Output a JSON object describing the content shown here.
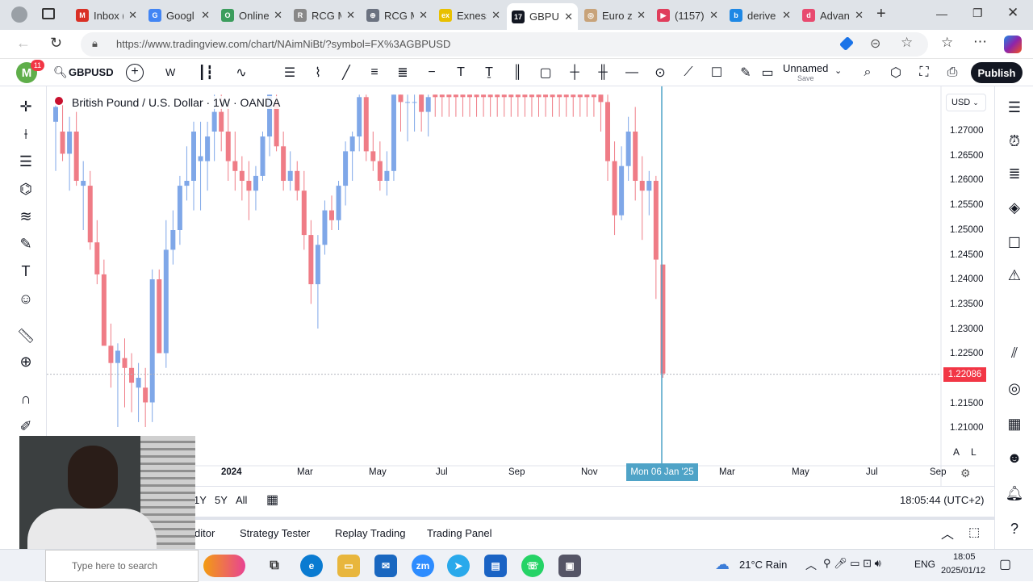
{
  "browser": {
    "tabs": [
      {
        "title": "Inbox (",
        "color": "#d93025",
        "glyph": "M"
      },
      {
        "title": "Googl",
        "color": "#4285f4",
        "glyph": "G"
      },
      {
        "title": "Online",
        "color": "#3c9d5d",
        "glyph": "O"
      },
      {
        "title": "RCG M",
        "color": "#888888",
        "glyph": "R"
      },
      {
        "title": "RCG M",
        "color": "#6b7280",
        "glyph": "⊕"
      },
      {
        "title": "Exness",
        "color": "#e8c000",
        "glyph": "ex"
      },
      {
        "title": "GBPUS",
        "color": "#131722",
        "glyph": "17",
        "active": true
      },
      {
        "title": "Euro z",
        "color": "#c8a37a",
        "glyph": "◎"
      },
      {
        "title": "(1157)",
        "color": "#e03e5c",
        "glyph": "▶"
      },
      {
        "title": "derive",
        "color": "#1e88e5",
        "glyph": "b"
      },
      {
        "title": "Advan",
        "color": "#e84a6f",
        "glyph": "d"
      }
    ],
    "url": "https://www.tradingview.com/chart/NAimNiBt/?symbol=FX%3AGBPUSD"
  },
  "header": {
    "avatar_letter": "M",
    "avatar_badge": "11",
    "symbol": "GBPUSD",
    "interval": "W",
    "layout_name": "Unnamed",
    "layout_sub": "Save",
    "publish_label": "Publish"
  },
  "chart": {
    "legend": "British Pound / U.S. Dollar · 1W · OANDA",
    "currency": "USD",
    "current_price": "1.22086",
    "crosshair_date": "Mon 06 Jan '25",
    "price_labels": [
      "1.27000",
      "1.26500",
      "1.26000",
      "1.25500",
      "1.25000",
      "1.24500",
      "1.24000",
      "1.23500",
      "1.23000",
      "1.22500",
      "1.22000",
      "1.21500",
      "1.21000"
    ],
    "time_labels": [
      "2024",
      "Mar",
      "May",
      "Jul",
      "Sep",
      "Nov",
      "Mar",
      "May",
      "Jul",
      "Sep"
    ],
    "scale_buttons": [
      "A",
      "L"
    ]
  },
  "chart_data": {
    "type": "candlestick",
    "title": "British Pound / U.S. Dollar · 1W · OANDA",
    "ylim": [
      1.205,
      1.2775
    ],
    "last_value": 1.22086,
    "note_candles": "weekly OHLC estimated from visible bodies",
    "candles": [
      {
        "o": 1.272,
        "h": 1.276,
        "l": 1.262,
        "c": 1.275
      },
      {
        "o": 1.27,
        "h": 1.2755,
        "l": 1.264,
        "c": 1.2655
      },
      {
        "o": 1.2655,
        "h": 1.273,
        "l": 1.258,
        "c": 1.27
      },
      {
        "o": 1.27,
        "h": 1.274,
        "l": 1.259,
        "c": 1.26
      },
      {
        "o": 1.259,
        "h": 1.264,
        "l": 1.25,
        "c": 1.26
      },
      {
        "o": 1.259,
        "h": 1.262,
        "l": 1.246,
        "c": 1.2475
      },
      {
        "o": 1.2475,
        "h": 1.252,
        "l": 1.239,
        "c": 1.241
      },
      {
        "o": 1.241,
        "h": 1.244,
        "l": 1.23,
        "c": 1.2265
      },
      {
        "o": 1.2265,
        "h": 1.231,
        "l": 1.218,
        "c": 1.223
      },
      {
        "o": 1.223,
        "h": 1.227,
        "l": 1.21,
        "c": 1.2255
      },
      {
        "o": 1.224,
        "h": 1.228,
        "l": 1.214,
        "c": 1.222
      },
      {
        "o": 1.222,
        "h": 1.225,
        "l": 1.213,
        "c": 1.219
      },
      {
        "o": 1.218,
        "h": 1.223,
        "l": 1.211,
        "c": 1.22
      },
      {
        "o": 1.218,
        "h": 1.222,
        "l": 1.21,
        "c": 1.215
      },
      {
        "o": 1.215,
        "h": 1.242,
        "l": 1.211,
        "c": 1.24
      },
      {
        "o": 1.24,
        "h": 1.242,
        "l": 1.225,
        "c": 1.225
      },
      {
        "o": 1.225,
        "h": 1.252,
        "l": 1.222,
        "c": 1.246
      },
      {
        "o": 1.246,
        "h": 1.254,
        "l": 1.243,
        "c": 1.25
      },
      {
        "o": 1.25,
        "h": 1.261,
        "l": 1.247,
        "c": 1.259
      },
      {
        "o": 1.259,
        "h": 1.267,
        "l": 1.256,
        "c": 1.26
      },
      {
        "o": 1.26,
        "h": 1.272,
        "l": 1.254,
        "c": 1.27
      },
      {
        "o": 1.264,
        "h": 1.272,
        "l": 1.254,
        "c": 1.265
      },
      {
        "o": 1.264,
        "h": 1.272,
        "l": 1.258,
        "c": 1.269
      },
      {
        "o": 1.27,
        "h": 1.2775,
        "l": 1.264,
        "c": 1.274
      },
      {
        "o": 1.274,
        "h": 1.2775,
        "l": 1.266,
        "c": 1.27
      },
      {
        "o": 1.27,
        "h": 1.276,
        "l": 1.26,
        "c": 1.264
      },
      {
        "o": 1.264,
        "h": 1.27,
        "l": 1.258,
        "c": 1.262
      },
      {
        "o": 1.262,
        "h": 1.265,
        "l": 1.256,
        "c": 1.26
      },
      {
        "o": 1.26,
        "h": 1.264,
        "l": 1.252,
        "c": 1.258
      },
      {
        "o": 1.258,
        "h": 1.263,
        "l": 1.254,
        "c": 1.261
      },
      {
        "o": 1.261,
        "h": 1.27,
        "l": 1.26,
        "c": 1.269
      },
      {
        "o": 1.269,
        "h": 1.2775,
        "l": 1.265,
        "c": 1.2775
      },
      {
        "o": 1.276,
        "h": 1.2775,
        "l": 1.266,
        "c": 1.267
      },
      {
        "o": 1.267,
        "h": 1.27,
        "l": 1.258,
        "c": 1.26
      },
      {
        "o": 1.26,
        "h": 1.266,
        "l": 1.258,
        "c": 1.262
      },
      {
        "o": 1.262,
        "h": 1.264,
        "l": 1.256,
        "c": 1.258
      },
      {
        "o": 1.258,
        "h": 1.262,
        "l": 1.246,
        "c": 1.249
      },
      {
        "o": 1.249,
        "h": 1.252,
        "l": 1.235,
        "c": 1.239
      },
      {
        "o": 1.239,
        "h": 1.249,
        "l": 1.23,
        "c": 1.247
      },
      {
        "o": 1.247,
        "h": 1.256,
        "l": 1.245,
        "c": 1.254
      },
      {
        "o": 1.254,
        "h": 1.257,
        "l": 1.25,
        "c": 1.252
      },
      {
        "o": 1.252,
        "h": 1.26,
        "l": 1.25,
        "c": 1.259
      },
      {
        "o": 1.259,
        "h": 1.268,
        "l": 1.255,
        "c": 1.266
      },
      {
        "o": 1.266,
        "h": 1.27,
        "l": 1.26,
        "c": 1.269
      },
      {
        "o": 1.269,
        "h": 1.2775,
        "l": 1.266,
        "c": 1.277
      },
      {
        "o": 1.277,
        "h": 1.2775,
        "l": 1.264,
        "c": 1.266
      },
      {
        "o": 1.266,
        "h": 1.27,
        "l": 1.262,
        "c": 1.264
      },
      {
        "o": 1.264,
        "h": 1.268,
        "l": 1.258,
        "c": 1.26
      },
      {
        "o": 1.26,
        "h": 1.266,
        "l": 1.257,
        "c": 1.262
      },
      {
        "o": 1.262,
        "h": 1.2775,
        "l": 1.26,
        "c": 1.2775
      },
      {
        "o": 1.2775,
        "h": 1.2775,
        "l": 1.27,
        "c": 1.276
      },
      {
        "o": 1.276,
        "h": 1.2775,
        "l": 1.268,
        "c": 1.276
      },
      {
        "o": 1.276,
        "h": 1.2775,
        "l": 1.27,
        "c": 1.276
      },
      {
        "o": 1.2775,
        "h": 1.2775,
        "l": 1.27,
        "c": 1.274
      },
      {
        "o": 1.274,
        "h": 1.2775,
        "l": 1.269,
        "c": 1.277
      },
      {
        "o": 1.2775,
        "h": 1.2775,
        "l": 1.273,
        "c": 1.277
      },
      {
        "o": 1.2775,
        "h": 1.2775,
        "l": 1.273,
        "c": 1.277
      },
      {
        "o": 1.2775,
        "h": 1.2775,
        "l": 1.273,
        "c": 1.277
      },
      {
        "o": 1.2775,
        "h": 1.2775,
        "l": 1.273,
        "c": 1.277
      },
      {
        "o": 1.2775,
        "h": 1.2775,
        "l": 1.273,
        "c": 1.277
      },
      {
        "o": 1.2775,
        "h": 1.2775,
        "l": 1.273,
        "c": 1.277
      },
      {
        "o": 1.2775,
        "h": 1.2775,
        "l": 1.273,
        "c": 1.277
      },
      {
        "o": 1.2775,
        "h": 1.2775,
        "l": 1.273,
        "c": 1.277
      },
      {
        "o": 1.2775,
        "h": 1.2775,
        "l": 1.273,
        "c": 1.277
      },
      {
        "o": 1.2775,
        "h": 1.2775,
        "l": 1.273,
        "c": 1.277
      },
      {
        "o": 1.2775,
        "h": 1.2775,
        "l": 1.273,
        "c": 1.277
      },
      {
        "o": 1.2775,
        "h": 1.2775,
        "l": 1.273,
        "c": 1.277
      },
      {
        "o": 1.2775,
        "h": 1.2775,
        "l": 1.273,
        "c": 1.277
      },
      {
        "o": 1.2775,
        "h": 1.2775,
        "l": 1.273,
        "c": 1.277
      },
      {
        "o": 1.2775,
        "h": 1.2775,
        "l": 1.273,
        "c": 1.277
      },
      {
        "o": 1.2775,
        "h": 1.2775,
        "l": 1.273,
        "c": 1.277
      },
      {
        "o": 1.2775,
        "h": 1.2775,
        "l": 1.273,
        "c": 1.277
      },
      {
        "o": 1.2775,
        "h": 1.2775,
        "l": 1.273,
        "c": 1.277
      },
      {
        "o": 1.2775,
        "h": 1.2775,
        "l": 1.273,
        "c": 1.277
      },
      {
        "o": 1.2775,
        "h": 1.2775,
        "l": 1.273,
        "c": 1.277
      },
      {
        "o": 1.2775,
        "h": 1.2775,
        "l": 1.273,
        "c": 1.277
      },
      {
        "o": 1.2775,
        "h": 1.2775,
        "l": 1.273,
        "c": 1.277
      },
      {
        "o": 1.2775,
        "h": 1.2775,
        "l": 1.273,
        "c": 1.277
      },
      {
        "o": 1.2775,
        "h": 1.2775,
        "l": 1.273,
        "c": 1.277
      },
      {
        "o": 1.2775,
        "h": 1.2775,
        "l": 1.27,
        "c": 1.276
      },
      {
        "o": 1.276,
        "h": 1.2775,
        "l": 1.26,
        "c": 1.264
      },
      {
        "o": 1.264,
        "h": 1.268,
        "l": 1.249,
        "c": 1.253
      },
      {
        "o": 1.253,
        "h": 1.267,
        "l": 1.252,
        "c": 1.263
      },
      {
        "o": 1.263,
        "h": 1.273,
        "l": 1.26,
        "c": 1.27
      },
      {
        "o": 1.27,
        "h": 1.275,
        "l": 1.256,
        "c": 1.26
      },
      {
        "o": 1.26,
        "h": 1.265,
        "l": 1.248,
        "c": 1.258
      },
      {
        "o": 1.258,
        "h": 1.262,
        "l": 1.253,
        "c": 1.26
      },
      {
        "o": 1.26,
        "h": 1.261,
        "l": 1.236,
        "c": 1.244
      },
      {
        "o": 1.243,
        "h": 1.243,
        "l": 1.22,
        "c": 1.22086
      }
    ]
  },
  "left_tools": [
    "crosshair-icon",
    "trend-line-icon",
    "fib-icon",
    "pattern-icon",
    "prediction-icon",
    "brush-icon",
    "text-icon",
    "emoji-icon",
    "ruler-icon",
    "zoom-icon",
    "magnet-icon",
    "lock-draw-icon"
  ],
  "right_tools": [
    "watchlist-icon",
    "alerts-clock-icon",
    "object-tree-icon",
    "layers-icon",
    "chat-icon",
    "notifications-icon",
    "pattern-draw-icon",
    "target-icon",
    "calendar-icon",
    "people-icon",
    "bell-icon",
    "help-icon"
  ],
  "range": {
    "buttons": [
      "1Y",
      "5Y",
      "All"
    ],
    "time": "18:05:44 (UTC+2)"
  },
  "panels": {
    "tabs": [
      "ditor",
      "Strategy Tester",
      "Replay Trading",
      "Trading Panel"
    ]
  },
  "taskbar": {
    "search_text": "Type here to search",
    "weather": "21°C  Rain",
    "lang": "ENG",
    "time": "18:05",
    "date": "2025/01/12"
  }
}
